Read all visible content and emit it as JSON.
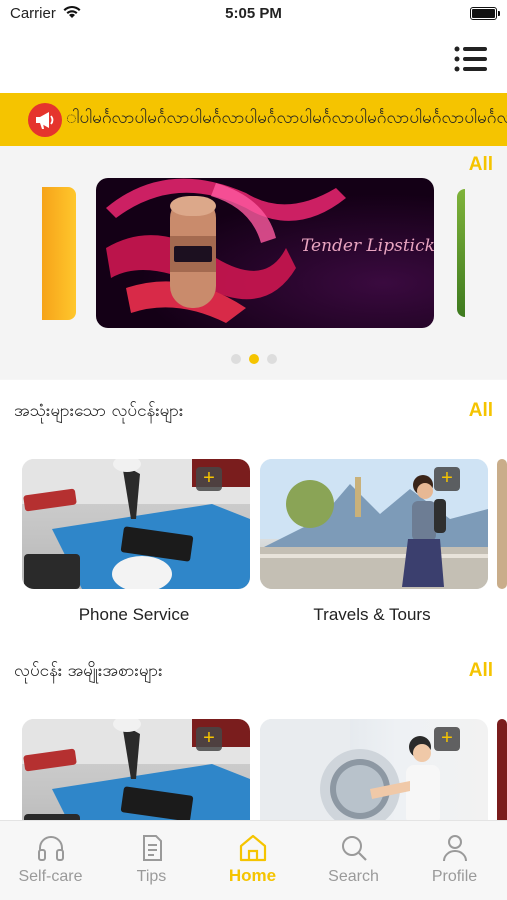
{
  "status": {
    "carrier": "Carrier",
    "time": "5:05 PM"
  },
  "marquee": {
    "text": "ါပါမင်္ဂလာပါမင်္ဂလာပါမင်္ဂလာပါမင်္ဂလာပါမင်္ဂလာပါမင်္ဂလာပါမင်္ဂလာပါမင်္ဂလာ"
  },
  "carousel": {
    "all_label": "All",
    "banner_title": "Tender Lipstick",
    "active_index": 1,
    "count": 3
  },
  "popular": {
    "title": "အသုံးများသော လုပ်ငန်းများ",
    "all_label": "All",
    "cards": [
      {
        "label": "Phone Service"
      },
      {
        "label": "Travels & Tours"
      }
    ]
  },
  "categories": {
    "title": "လုပ်ငန်း အမျိုးအစားများ",
    "all_label": "All"
  },
  "card_plus": "+",
  "tabs": [
    {
      "label": "Self-care",
      "icon": "headphones-icon"
    },
    {
      "label": "Tips",
      "icon": "document-icon"
    },
    {
      "label": "Home",
      "icon": "home-icon"
    },
    {
      "label": "Search",
      "icon": "search-icon"
    },
    {
      "label": "Profile",
      "icon": "person-icon"
    }
  ],
  "colors": {
    "accent": "#f5c400",
    "marquee_bg": "#f5c400",
    "megaphone": "#e5342d",
    "inactive": "#9a9a9a"
  }
}
